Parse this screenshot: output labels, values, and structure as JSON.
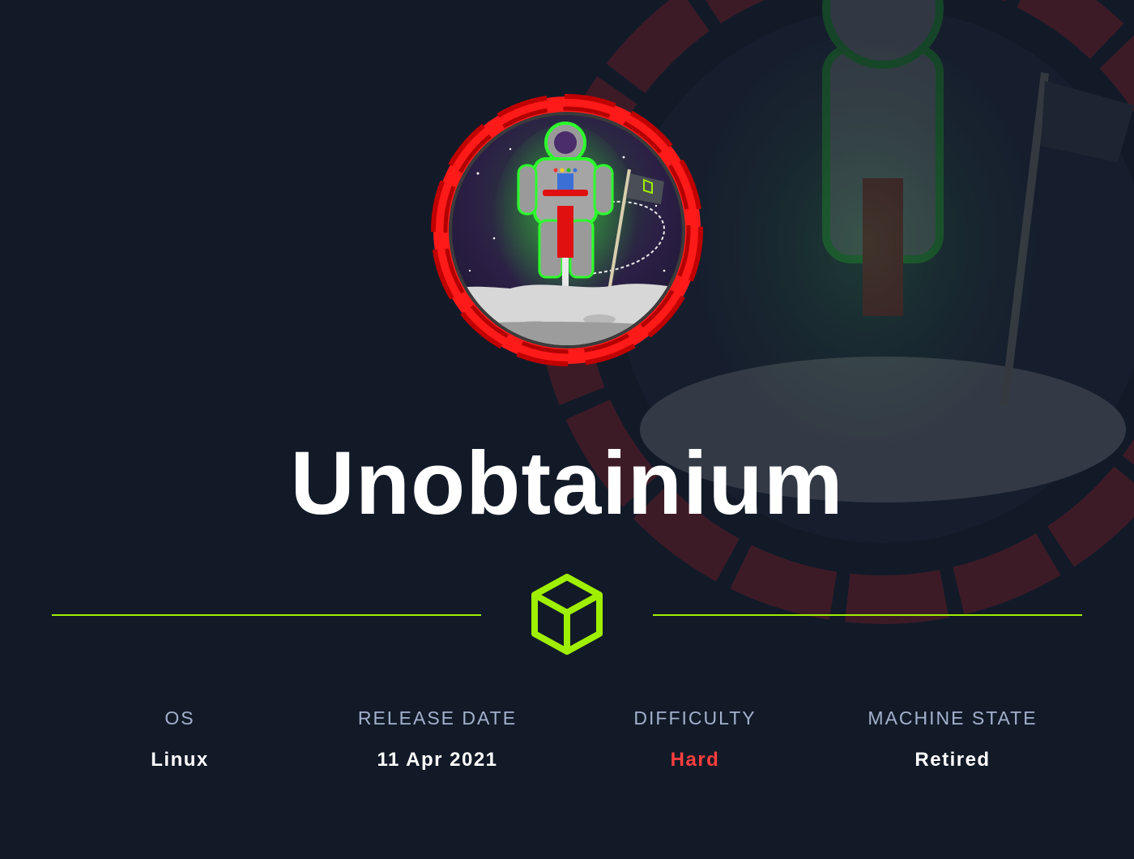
{
  "machine": {
    "name": "Unobtainium"
  },
  "info": [
    {
      "label": "OS",
      "value": "Linux"
    },
    {
      "label": "RELEASE DATE",
      "value": "11 Apr 2021"
    },
    {
      "label": "DIFFICULTY",
      "value": "Hard"
    },
    {
      "label": "MACHINE STATE",
      "value": "Retired"
    }
  ],
  "colors": {
    "background": "#121a28",
    "accent_green": "#9fef00",
    "difficulty_hard": "#ff3e3e",
    "avatar_ring": "#ff1a1a",
    "label_gray": "#a4b1cd"
  },
  "icons": {
    "logo": "hackthebox-cube-icon",
    "avatar": "astronaut-avatar"
  }
}
